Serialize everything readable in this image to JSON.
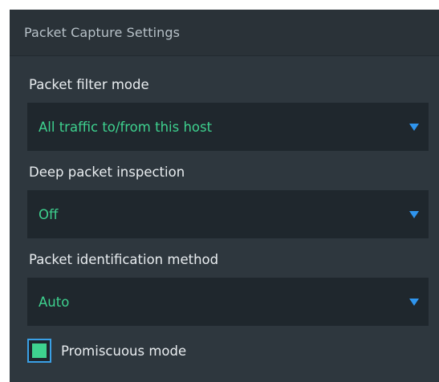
{
  "panel": {
    "title": "Packet Capture Settings"
  },
  "fields": [
    {
      "label": "Packet filter mode",
      "value": "All traffic to/from this host"
    },
    {
      "label": "Deep packet inspection",
      "value": "Off"
    },
    {
      "label": "Packet identification method",
      "value": "Auto"
    }
  ],
  "promiscuous": {
    "label": "Promiscuous mode",
    "checked": true
  },
  "colors": {
    "panel_bg": "#2e373e",
    "header_bg": "#2a3238",
    "select_bg": "#1f272d",
    "value_text": "#3ed28f",
    "caret": "#2f95ee",
    "checkbox_border": "#3aa0e6"
  },
  "icons": {
    "dropdown": "chevron-down-icon",
    "checkbox": "checkbox-checked-icon"
  }
}
